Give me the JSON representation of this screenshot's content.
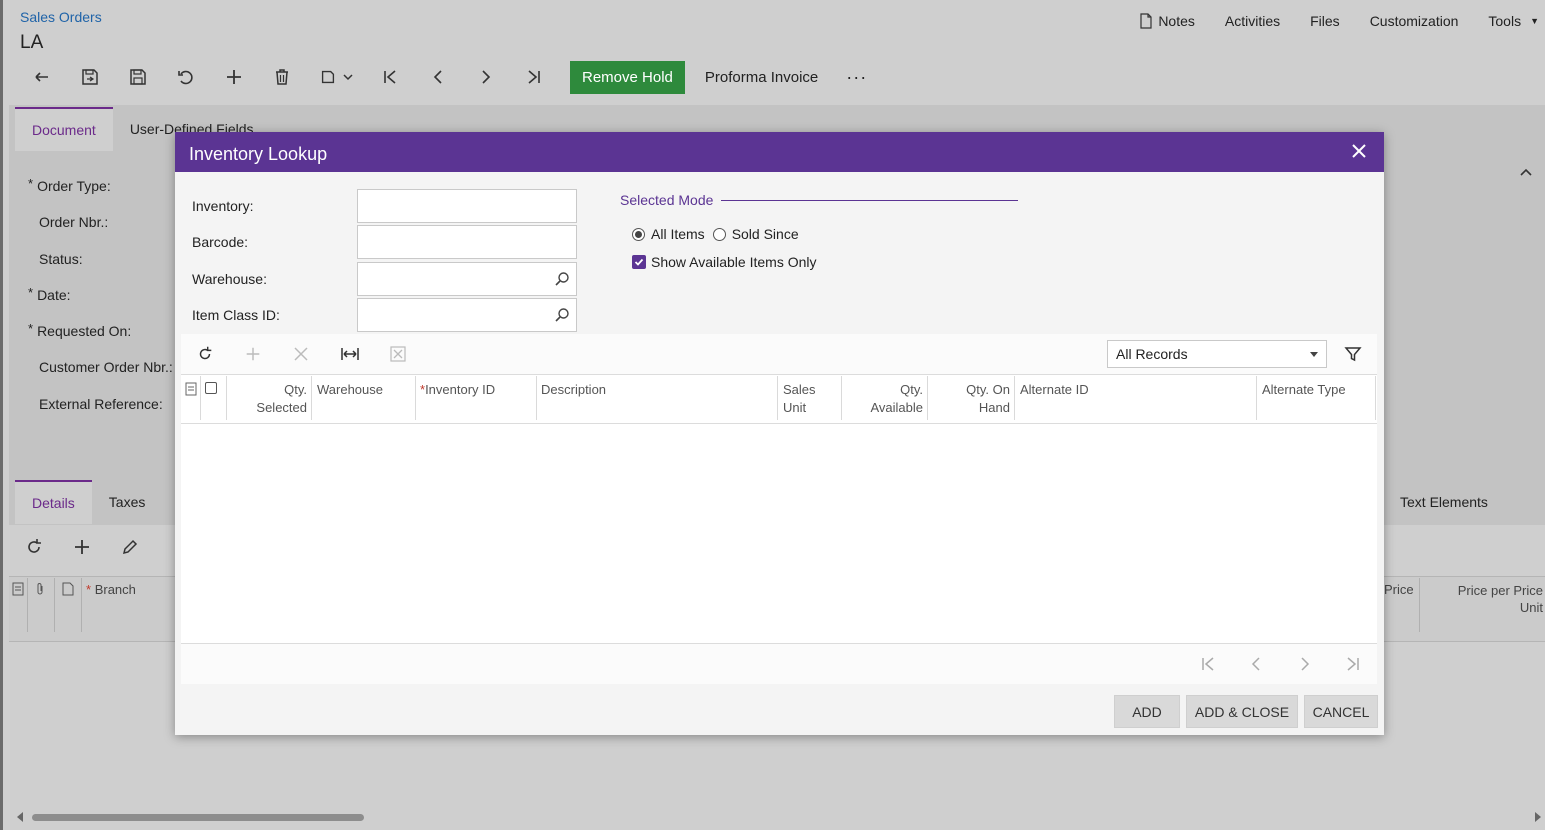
{
  "header": {
    "breadcrumb": "Sales Orders",
    "title": "LA",
    "links": [
      {
        "label": "Notes",
        "icon": "document-icon"
      },
      {
        "label": "Activities"
      },
      {
        "label": "Files"
      },
      {
        "label": "Customization"
      },
      {
        "label": "Tools",
        "icon": "caret-down-icon"
      }
    ]
  },
  "toolbar": {
    "icons": [
      "back-icon",
      "save-close-icon",
      "save-icon",
      "undo-icon",
      "add-icon",
      "delete-icon",
      "copy-paste-icon",
      "first-record-icon",
      "previous-record-icon",
      "next-record-icon",
      "last-record-icon"
    ],
    "remove_hold_label": "Remove Hold",
    "remove_hold_color": "#2e8a3c",
    "proforma_label": "Proforma Invoice",
    "more_label": "···"
  },
  "doc_tabs": [
    {
      "label": "Document",
      "active": true
    },
    {
      "label": "User-Defined Fields",
      "active": false
    }
  ],
  "form_fields": [
    {
      "label": "Order Type:",
      "required": true
    },
    {
      "label": "Order Nbr.:",
      "required": false
    },
    {
      "label": "Status:",
      "required": false
    },
    {
      "label": "Date:",
      "required": true
    },
    {
      "label": "Requested On:",
      "required": true
    },
    {
      "label": "Customer Order Nbr.:",
      "required": false
    },
    {
      "label": "External Reference:",
      "required": false
    }
  ],
  "detail_tabs": [
    {
      "label": "Details",
      "active": true
    },
    {
      "label": "Taxes",
      "active": false
    }
  ],
  "text_elements_tab": "Text Elements",
  "detail_grid": {
    "branch_header": "Branch",
    "price_header": "Price",
    "price_per_unit_header_line1": "Price per Price",
    "price_per_unit_header_line2": "Unit"
  },
  "modal": {
    "title": "Inventory Lookup",
    "accent": "#5b3493",
    "fields": [
      {
        "label": "Inventory:",
        "value": ""
      },
      {
        "label": "Barcode:",
        "value": ""
      },
      {
        "label": "Warehouse:",
        "value": ""
      },
      {
        "label": "Item Class ID:",
        "value": ""
      }
    ],
    "selected_mode_label": "Selected Mode",
    "radio_all_items": "All Items",
    "radio_sold_since": "Sold Since",
    "show_available_label": "Show Available Items Only",
    "show_available_checked": true,
    "records_filter": "All Records",
    "columns": {
      "qty_selected_1": "Qty.",
      "qty_selected_2": "Selected",
      "warehouse": "Warehouse",
      "inventory_id": "Inventory ID",
      "description": "Description",
      "sales_unit_1": "Sales",
      "sales_unit_2": "Unit",
      "qty_available_1": "Qty.",
      "qty_available_2": "Available",
      "qty_on_hand_1": "Qty. On",
      "qty_on_hand_2": "Hand",
      "alternate_id": "Alternate ID",
      "alternate_type": "Alternate Type"
    },
    "buttons": {
      "add": "ADD",
      "add_close": "ADD & CLOSE",
      "cancel": "CANCEL"
    }
  }
}
